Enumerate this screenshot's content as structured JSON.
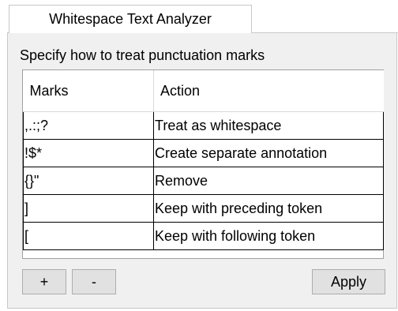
{
  "tab": {
    "title": "Whitespace Text Analyzer"
  },
  "panel": {
    "instruction": "Specify how to treat punctuation marks"
  },
  "table": {
    "headers": [
      "Marks",
      "Action"
    ],
    "rows": [
      {
        "marks": ",.:;?",
        "action": "Treat as whitespace"
      },
      {
        "marks": "!$*",
        "action": "Create separate annotation"
      },
      {
        "marks": "{}\"",
        "action": "Remove"
      },
      {
        "marks": "]",
        "action": "Keep with preceding token"
      },
      {
        "marks": "[",
        "action": "Keep with following token"
      }
    ]
  },
  "buttons": {
    "add": "+",
    "remove": "-",
    "apply": "Apply"
  }
}
